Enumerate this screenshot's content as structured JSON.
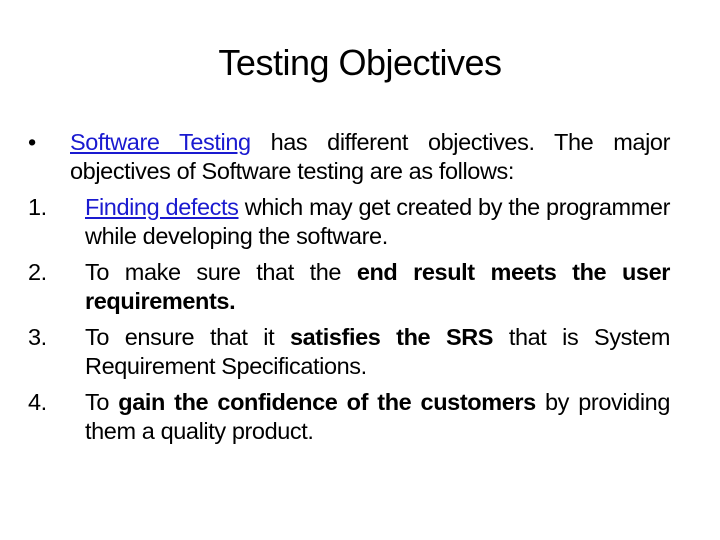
{
  "slide": {
    "title": "Testing Objectives",
    "intro": {
      "bullet": "•",
      "link1": "Software ",
      "link2": "Testing",
      "text": " has different objectives. The major objectives of Software testing are as follows:"
    },
    "items": [
      {
        "num": "1.",
        "link1": "Finding ",
        "link2": "defects",
        "text": " which may get created by the programmer while developing the software."
      },
      {
        "num": "2.",
        "pre": "To make sure that the ",
        "bold": "end result meets the user requirements.",
        "post": ""
      },
      {
        "num": "3.",
        "pre": "To ensure that it ",
        "bold": "satisfies the SRS",
        "post": " that is System Requirement Specifications."
      },
      {
        "num": "4.",
        "pre": "To ",
        "bold": "gain the confidence of the customers",
        "post": " by providing them a quality product."
      }
    ],
    "colors": {
      "link": "#1a1ad0",
      "text": "#000000",
      "background": "#ffffff"
    }
  }
}
